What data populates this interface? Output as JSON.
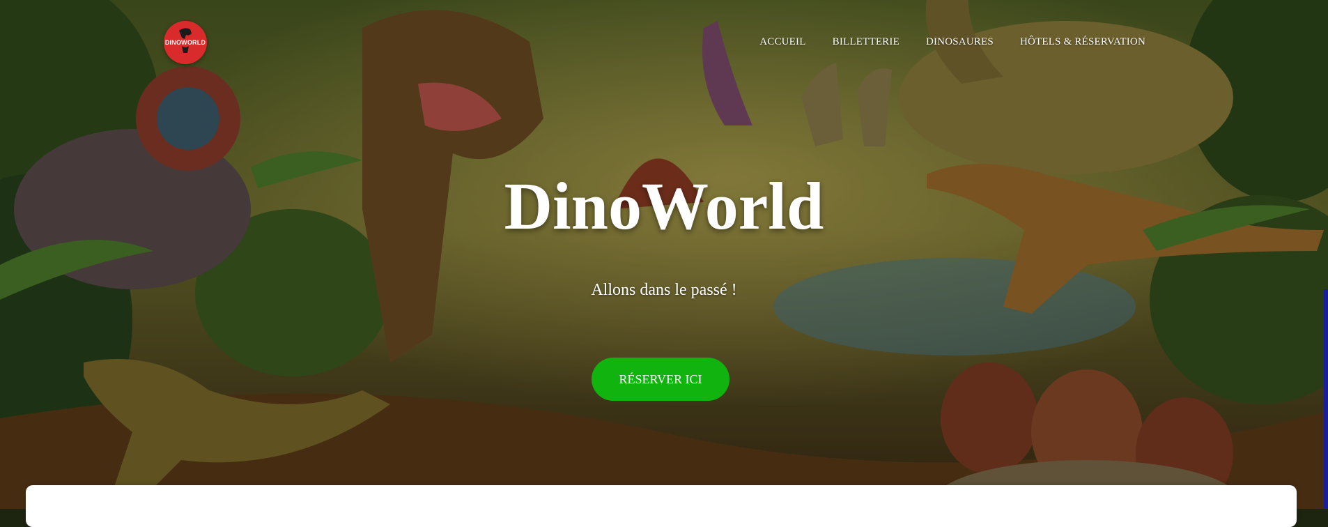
{
  "header": {
    "logo_text": "DinoWorld",
    "nav": [
      {
        "label": "ACCUEIL"
      },
      {
        "label": "BILLETTERIE"
      },
      {
        "label": "DINOSAURES"
      },
      {
        "label": "HÔTELS & RÉSERVATION"
      }
    ]
  },
  "hero": {
    "title": "DinoWorld",
    "subtitle": "Allons dans le passé !",
    "cta_label": "RÉSERVER ICI",
    "background": "prehistoric-jungle-dinosaurs-illustration"
  },
  "colors": {
    "cta": "#11b30e",
    "logo": "#d92b2b",
    "text": "#ffffff",
    "card": "#ffffff",
    "scroll_edge": "#1a1f99"
  }
}
